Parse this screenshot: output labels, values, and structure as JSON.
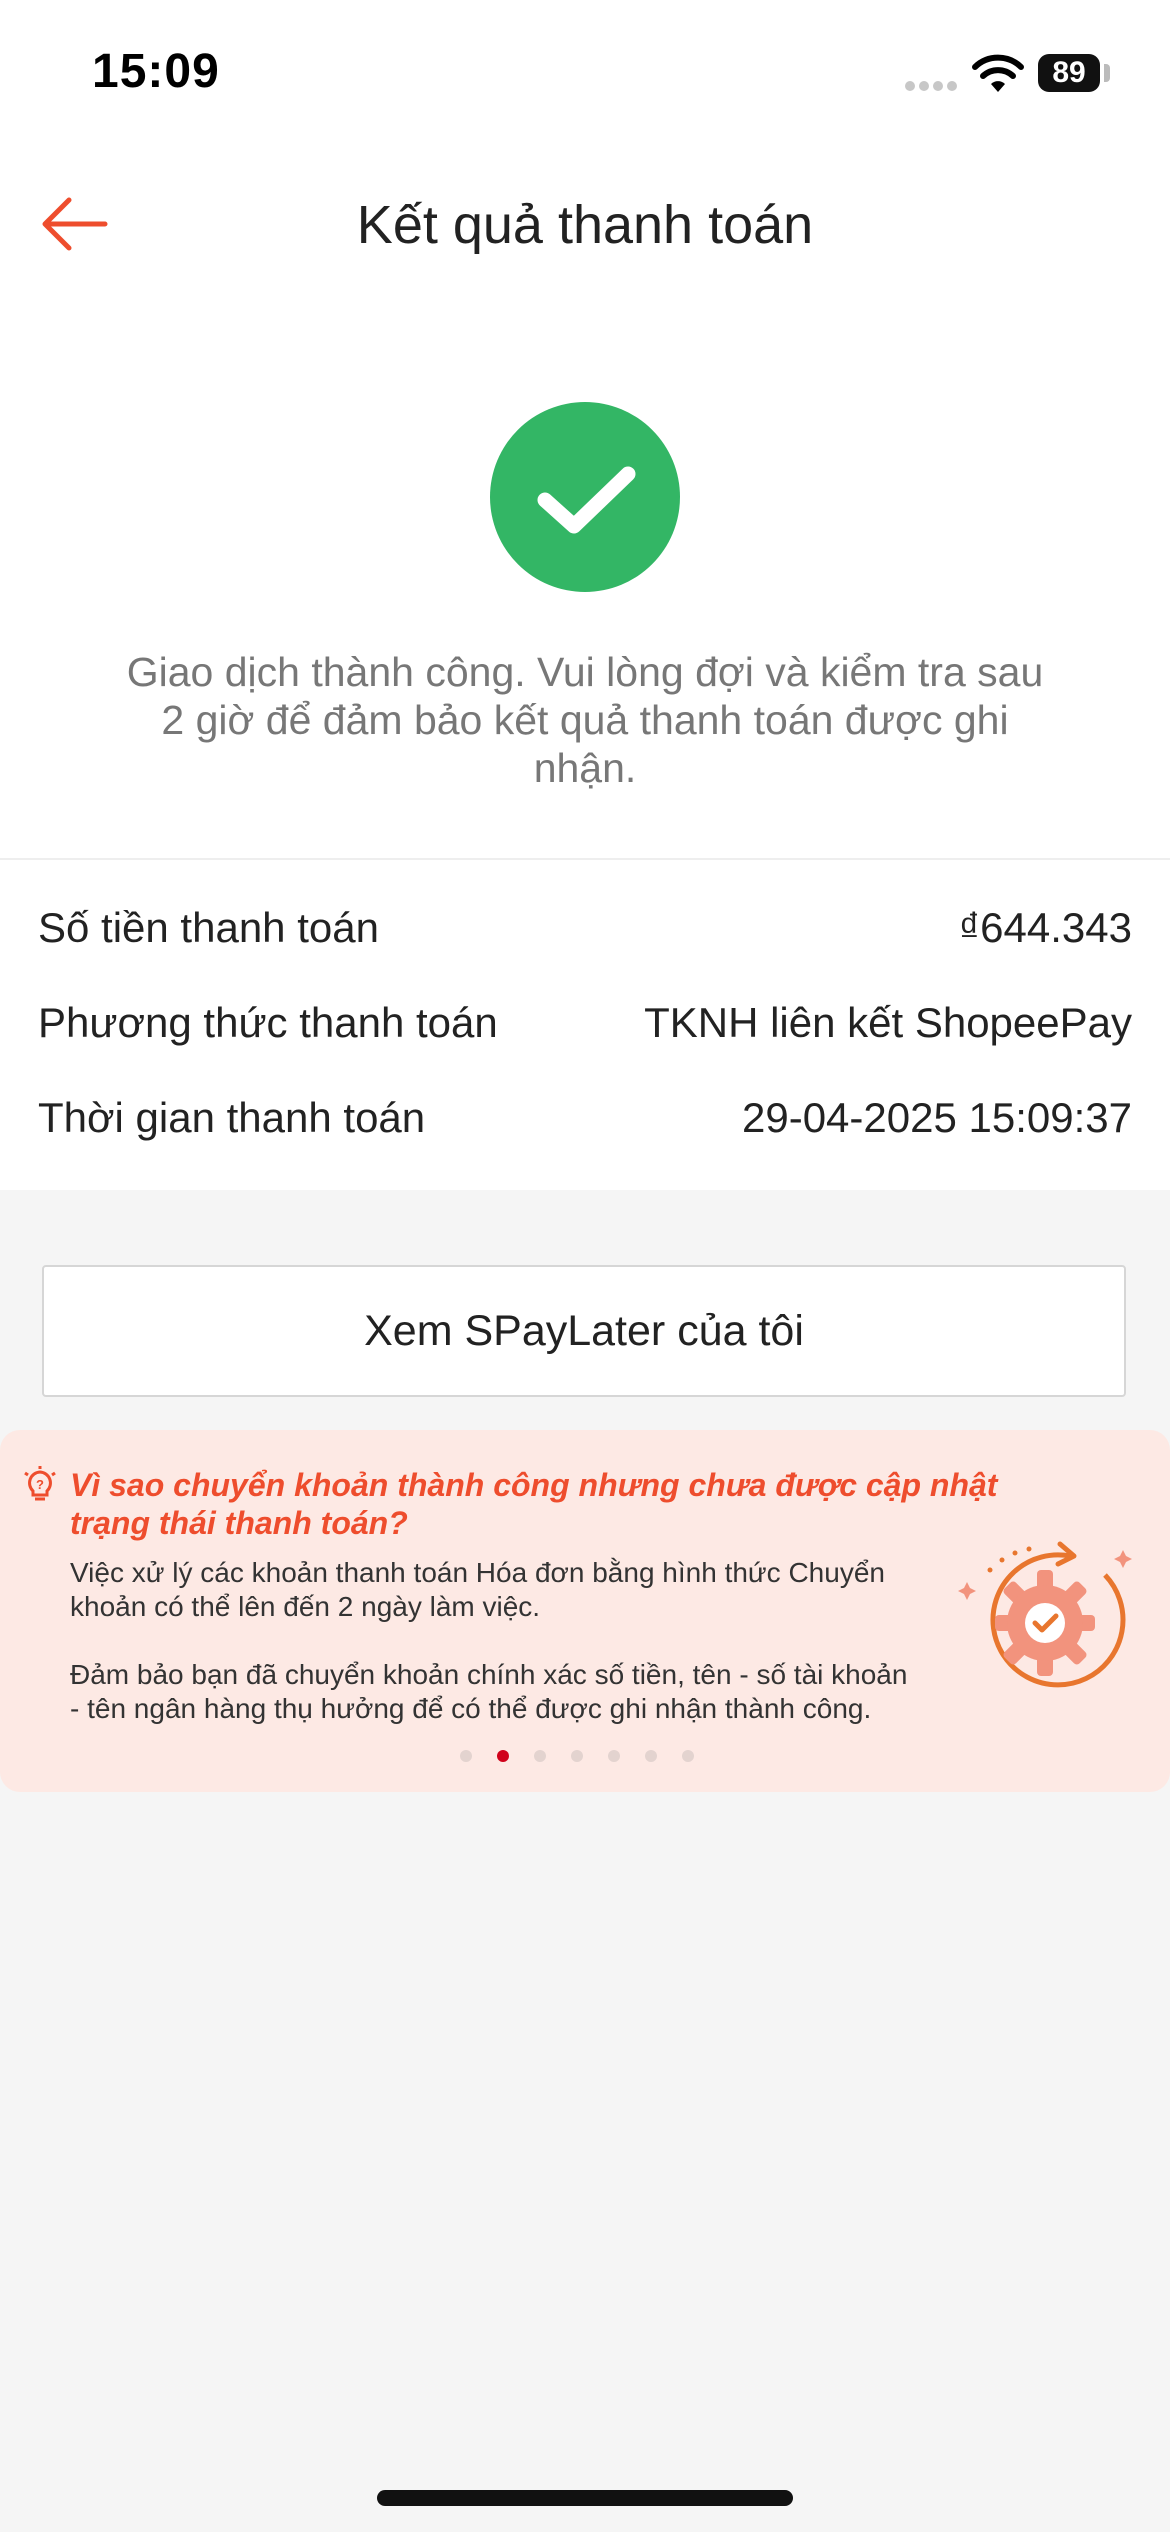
{
  "status_bar": {
    "time": "15:09",
    "battery": "89"
  },
  "header": {
    "title": "Kết quả thanh toán"
  },
  "result": {
    "message": "Giao dịch thành công. Vui lòng đợi và kiểm tra sau 2 giờ để đảm bảo kết quả thanh toán được ghi nhận.",
    "icon": "check-circle-icon",
    "icon_color": "#33b665"
  },
  "details": [
    {
      "label": "Số tiền thanh toán",
      "value": "₫644.343"
    },
    {
      "label": "Phương thức thanh toán",
      "value": "TKNH liên kết ShopeePay"
    },
    {
      "label": "Thời gian thanh toán",
      "value": "29-04-2025 15:09:37"
    }
  ],
  "cta": {
    "label": "Xem SPayLater của tôi"
  },
  "banner": {
    "title": "Vì sao chuyển khoản thành công nhưng chưa được cập nhật trạng thái thanh toán?",
    "paragraph_1": "Việc xử lý các khoản thanh toán Hóa đơn bằng hình thức Chuyển khoản có thể lên đến 2 ngày làm việc.",
    "paragraph_2": "Đảm bảo bạn đã chuyển khoản chính xác số tiền, tên - số tài khoản - tên ngân hàng thụ hưởng để có thể được ghi nhận thành công.",
    "dot_count": 7,
    "active_dot": 2,
    "accent_color": "#ee4d2d",
    "background_color": "#fde9e4"
  },
  "colors": {
    "brand": "#ee4d2d",
    "success": "#33b665",
    "page_bg": "#f5f5f5"
  }
}
